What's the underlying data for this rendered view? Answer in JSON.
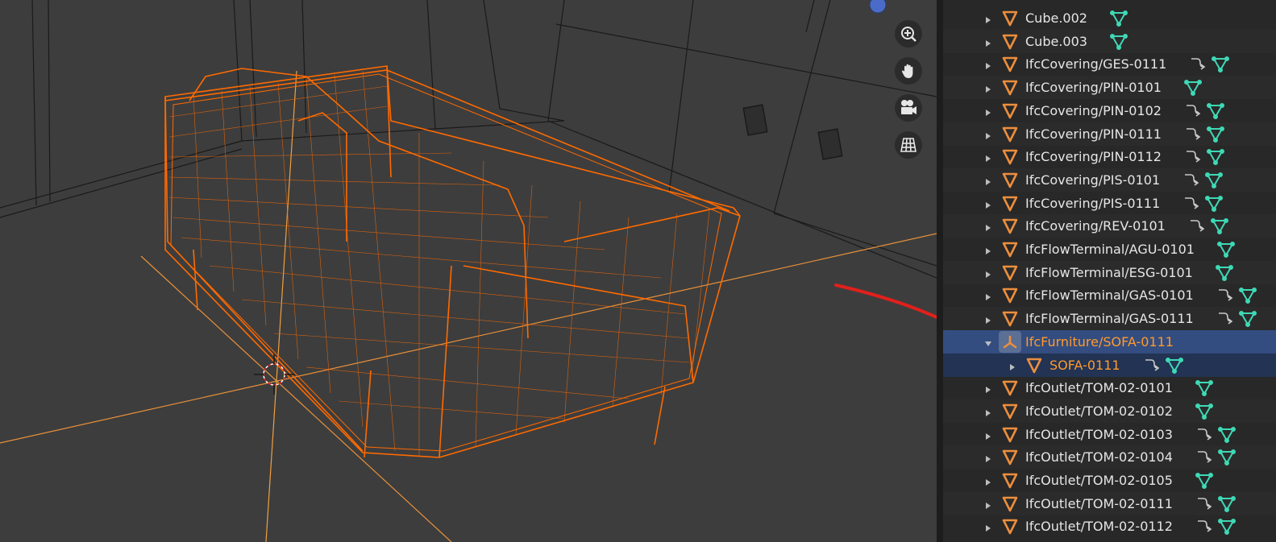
{
  "window": {
    "title": ""
  },
  "viewport": {
    "tools": [
      {
        "name": "zoom",
        "icon": "zoom-in-icon"
      },
      {
        "name": "pan",
        "icon": "hand-icon"
      },
      {
        "name": "camera",
        "icon": "camera-icon"
      },
      {
        "name": "ortho",
        "icon": "grid-icon"
      }
    ],
    "selection_color": "#ff6a00"
  },
  "outliner": {
    "items": [
      {
        "label": "Cube.002",
        "modifier": false,
        "mesh": true,
        "state": "normal"
      },
      {
        "label": "Cube.003",
        "modifier": false,
        "mesh": true,
        "state": "normal"
      },
      {
        "label": "IfcCovering/GES-0111",
        "modifier": true,
        "mesh": true,
        "state": "normal"
      },
      {
        "label": "IfcCovering/PIN-0101",
        "modifier": false,
        "mesh": true,
        "state": "normal"
      },
      {
        "label": "IfcCovering/PIN-0102",
        "modifier": true,
        "mesh": true,
        "state": "normal"
      },
      {
        "label": "IfcCovering/PIN-0111",
        "modifier": true,
        "mesh": true,
        "state": "normal"
      },
      {
        "label": "IfcCovering/PIN-0112",
        "modifier": true,
        "mesh": true,
        "state": "normal"
      },
      {
        "label": "IfcCovering/PIS-0101",
        "modifier": true,
        "mesh": true,
        "state": "normal"
      },
      {
        "label": "IfcCovering/PIS-0111",
        "modifier": true,
        "mesh": true,
        "state": "normal"
      },
      {
        "label": "IfcCovering/REV-0101",
        "modifier": true,
        "mesh": true,
        "state": "normal"
      },
      {
        "label": "IfcFlowTerminal/AGU-0101",
        "modifier": false,
        "mesh": true,
        "state": "normal"
      },
      {
        "label": "IfcFlowTerminal/ESG-0101",
        "modifier": false,
        "mesh": true,
        "state": "normal"
      },
      {
        "label": "IfcFlowTerminal/GAS-0101",
        "modifier": true,
        "mesh": true,
        "state": "normal"
      },
      {
        "label": "IfcFlowTerminal/GAS-0111",
        "modifier": true,
        "mesh": true,
        "state": "normal"
      },
      {
        "label": "IfcFurniture/SOFA-0111",
        "modifier": false,
        "mesh": false,
        "state": "active",
        "empty": true
      },
      {
        "label": "SOFA-0111",
        "modifier": true,
        "mesh": true,
        "state": "selected-child"
      },
      {
        "label": "IfcOutlet/TOM-02-0101",
        "modifier": false,
        "mesh": true,
        "state": "normal"
      },
      {
        "label": "IfcOutlet/TOM-02-0102",
        "modifier": false,
        "mesh": true,
        "state": "normal"
      },
      {
        "label": "IfcOutlet/TOM-02-0103",
        "modifier": true,
        "mesh": true,
        "state": "normal"
      },
      {
        "label": "IfcOutlet/TOM-02-0104",
        "modifier": true,
        "mesh": true,
        "state": "normal"
      },
      {
        "label": "IfcOutlet/TOM-02-0105",
        "modifier": false,
        "mesh": true,
        "state": "normal"
      },
      {
        "label": "IfcOutlet/TOM-02-0111",
        "modifier": true,
        "mesh": true,
        "state": "normal"
      },
      {
        "label": "IfcOutlet/TOM-02-0112",
        "modifier": true,
        "mesh": true,
        "state": "normal"
      }
    ]
  },
  "annotation": {
    "arrow_color": "#e0201c"
  },
  "colors": {
    "viewport_bg": "#3d3d3d",
    "outliner_bg": "#282828",
    "active_row": "#334d80",
    "selected_row": "#223353",
    "highlight_text": "#ff9a2e",
    "mesh_icon": "#3ed9b5",
    "object_icon": "#ec8e3d"
  }
}
